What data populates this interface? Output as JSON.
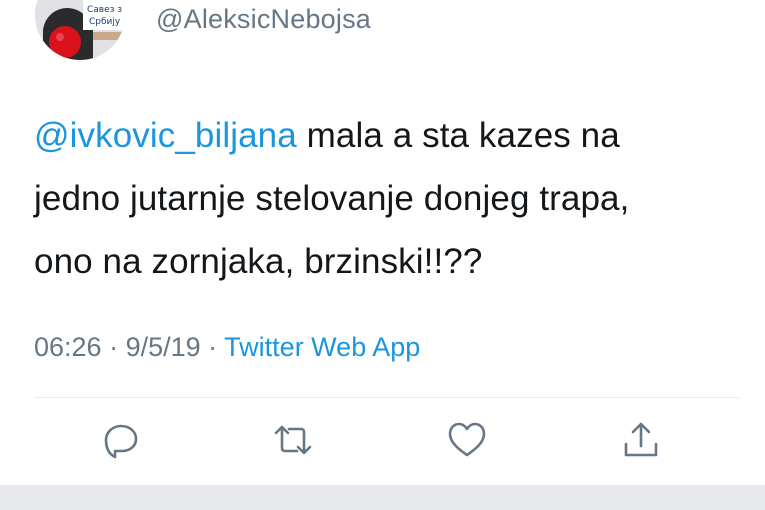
{
  "tweet": {
    "handle": "@AleksicNebojsa",
    "avatar_badge": "Савез з\nСрбију",
    "mention": "@ivkovic_biljana",
    "body_line1_rest": " mala a sta kazes na",
    "body_line2": "jedno jutarnje stelovanje donjeg trapa,",
    "body_line3": "ono na zornjaka, brzinski!!??",
    "time": "06:26",
    "separator": " · ",
    "date": "9/5/19",
    "source": "Twitter Web App"
  },
  "actions": [
    {
      "icon": "reply-icon"
    },
    {
      "icon": "retweet-icon"
    },
    {
      "icon": "like-icon"
    },
    {
      "icon": "share-icon"
    }
  ],
  "colors": {
    "accent": "#1b95e0",
    "text": "#14171a",
    "muted": "#657786",
    "divider": "#e6ecf0"
  }
}
